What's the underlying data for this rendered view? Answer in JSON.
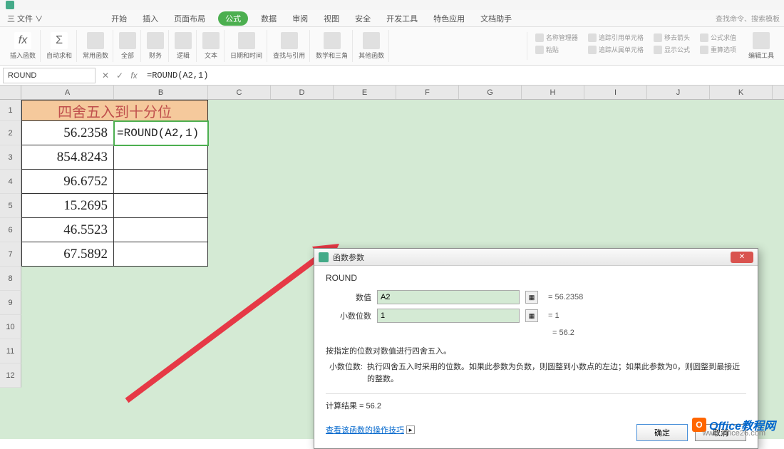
{
  "menubar": {
    "items": [
      "三 文件 ∨",
      "开始",
      "插入",
      "页面布局",
      "公式",
      "数据",
      "审阅",
      "视图",
      "安全",
      "开发工具",
      "特色应用",
      "文档助手"
    ],
    "active_index": 4,
    "search_placeholder": "查找命令、搜索模板"
  },
  "ribbon": {
    "groups": [
      {
        "icon": "fx",
        "label": "插入函数"
      },
      {
        "icon": "Σ",
        "label": "自动求和"
      },
      {
        "icon": "★",
        "label": "常用函数"
      },
      {
        "icon": "■",
        "label": "全部"
      },
      {
        "icon": "¥",
        "label": "财务"
      },
      {
        "icon": "?",
        "label": "逻辑"
      },
      {
        "icon": "A",
        "label": "文本"
      },
      {
        "icon": "⏰",
        "label": "日期和时间"
      },
      {
        "icon": "🔍",
        "label": "查找与引用"
      },
      {
        "icon": "θ",
        "label": "数学和三角"
      },
      {
        "icon": "⋯",
        "label": "其他函数"
      }
    ],
    "right_groups": [
      {
        "label1": "名称管理器",
        "label2": "粘贴"
      },
      {
        "label1": "追踪引用单元格",
        "label2": "追踪从属单元格"
      },
      {
        "label1": "移去箭头",
        "label2": "显示公式"
      },
      {
        "label1": "公式求值",
        "label2": "重算选项"
      },
      {
        "label1": "",
        "label2": "编辑工具"
      }
    ]
  },
  "formula_bar": {
    "name_box": "ROUND",
    "formula": "=ROUND(A2,1)"
  },
  "columns": [
    "A",
    "B",
    "C",
    "D",
    "E",
    "F",
    "G",
    "H",
    "I",
    "J",
    "K"
  ],
  "sheet": {
    "header_merged": "四舍五入到十分位",
    "rows": [
      {
        "num": "1"
      },
      {
        "num": "2",
        "a": "56.2358",
        "b": "=ROUND(A2,1)"
      },
      {
        "num": "3",
        "a": "854.8243"
      },
      {
        "num": "4",
        "a": "96.6752"
      },
      {
        "num": "5",
        "a": "15.2695"
      },
      {
        "num": "6",
        "a": "46.5523"
      },
      {
        "num": "7",
        "a": "67.5892"
      },
      {
        "num": "8"
      },
      {
        "num": "9"
      },
      {
        "num": "10"
      },
      {
        "num": "11"
      },
      {
        "num": "12"
      }
    ]
  },
  "dialog": {
    "title": "函数参数",
    "func_name": "ROUND",
    "params": [
      {
        "label": "数值",
        "value": "A2",
        "result": "= 56.2358"
      },
      {
        "label": "小数位数",
        "value": "1",
        "result": "= 1"
      }
    ],
    "preview": "= 56.2",
    "desc_main": "按指定的位数对数值进行四舍五入。",
    "desc_sub_label": "小数位数:",
    "desc_sub_text": "执行四舍五入时采用的位数。如果此参数为负数，则圆整到小数点的左边；如果此参数为0，则圆整到最接近的整数。",
    "calc_result_label": "计算结果 =",
    "calc_result_value": "56.2",
    "help_link": "查看该函数的操作技巧",
    "btn_ok": "确定",
    "btn_cancel": "取消"
  },
  "watermark": {
    "text": "Office教程网",
    "url": "www.office26.com"
  },
  "chart_data": {
    "type": "table",
    "title": "四舍五入到十分位",
    "categories": [
      "A2",
      "A3",
      "A4",
      "A5",
      "A6",
      "A7"
    ],
    "values": [
      56.2358,
      854.8243,
      96.6752,
      15.2695,
      46.5523,
      67.5892
    ],
    "formula": "=ROUND(A2,1)",
    "rounded_example": 56.2
  }
}
